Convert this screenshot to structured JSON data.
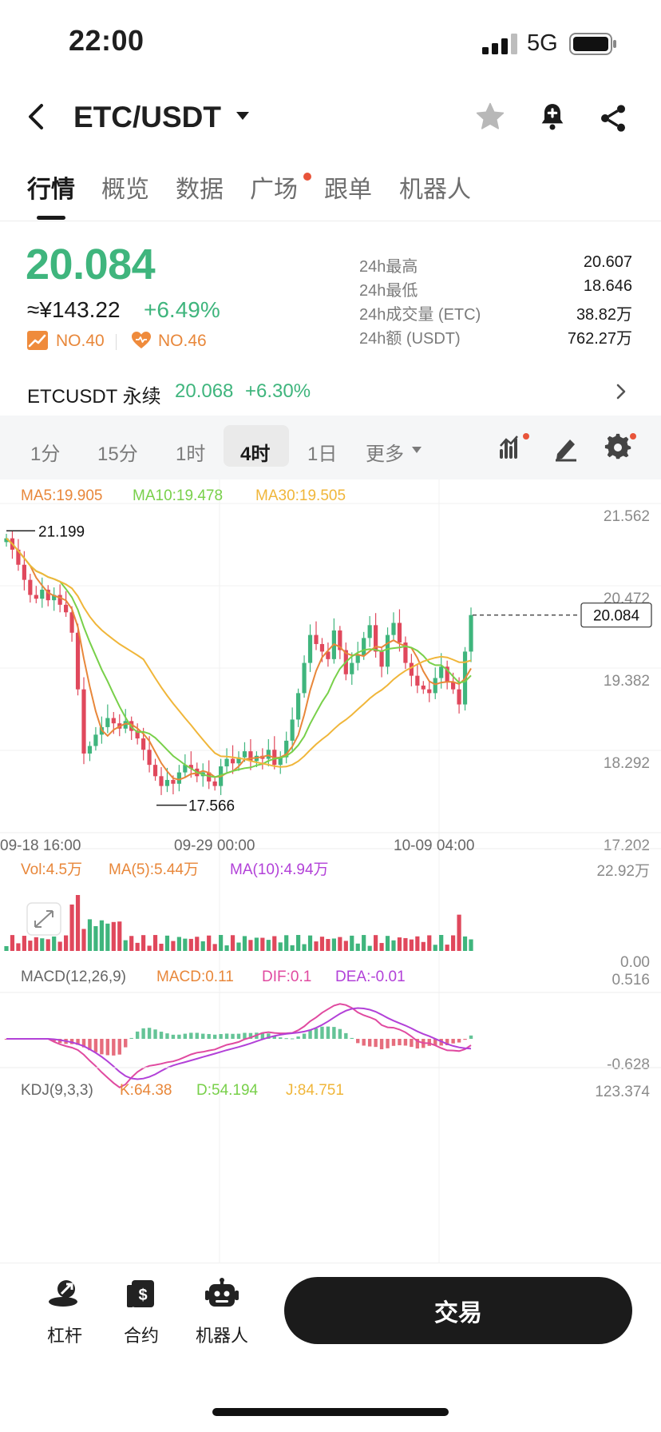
{
  "status": {
    "time": "22:00",
    "network": "5G"
  },
  "header": {
    "pair": "ETC/USDT",
    "icons": [
      "back-icon",
      "caret-down-icon",
      "star-icon",
      "bell-plus-icon",
      "share-icon"
    ]
  },
  "tabs": [
    {
      "label": "行情",
      "active": true
    },
    {
      "label": "概览"
    },
    {
      "label": "数据"
    },
    {
      "label": "广场",
      "dot": true
    },
    {
      "label": "跟单"
    },
    {
      "label": "机器人"
    }
  ],
  "ticker": {
    "price": "20.084",
    "cny": "≈¥143.22",
    "change": "+6.49%",
    "rank1": "NO.40",
    "rank2": "NO.46"
  },
  "stats": [
    {
      "label": "24h最高",
      "value": "20.607"
    },
    {
      "label": "24h最低",
      "value": "18.646"
    },
    {
      "label": "24h成交量 (ETC)",
      "value": "38.82万"
    },
    {
      "label": "24h额 (USDT)",
      "value": "762.27万"
    }
  ],
  "perp": {
    "label": "ETCUSDT 永续",
    "price": "20.068",
    "change": "+6.30%"
  },
  "timeframes": [
    {
      "label": "1分"
    },
    {
      "label": "15分"
    },
    {
      "label": "1时"
    },
    {
      "label": "4时",
      "active": true
    },
    {
      "label": "1日"
    },
    {
      "label": "更多"
    }
  ],
  "colors": {
    "up": "#3fb57d",
    "down": "#e0485c",
    "ma5": "#e8873a",
    "ma10": "#78d04a",
    "ma30": "#f0b63a",
    "purple": "#b241d8",
    "macd": "#e8873a",
    "dif": "#e04aa0"
  },
  "chart_data": {
    "type": "candlestick",
    "indicators": {
      "ma5": "MA5:19.905",
      "ma10": "MA10:19.478",
      "ma30": "MA30:19.505"
    },
    "y_ticks": [
      "21.562",
      "20.472",
      "19.382",
      "18.292",
      "17.202"
    ],
    "ylim": [
      17.202,
      21.562
    ],
    "x_ticks": [
      "09-18 16:00",
      "09-29 00:00",
      "10-09 04:00"
    ],
    "high_label": "21.199",
    "low_label": "17.566",
    "current_price": "20.084",
    "closes": [
      21.1,
      20.95,
      20.75,
      20.55,
      20.35,
      20.3,
      20.42,
      20.28,
      20.35,
      20.22,
      20.12,
      19.85,
      19.1,
      18.25,
      18.35,
      18.5,
      18.6,
      18.72,
      18.65,
      18.58,
      18.68,
      18.55,
      18.45,
      18.3,
      18.1,
      17.95,
      17.82,
      17.9,
      17.85,
      18.0,
      18.1,
      18.05,
      17.95,
      18.0,
      17.88,
      17.82,
      18.08,
      18.18,
      18.12,
      18.2,
      18.28,
      18.15,
      18.22,
      18.18,
      18.3,
      18.1,
      18.2,
      18.42,
      18.7,
      19.05,
      19.45,
      19.82,
      19.7,
      19.6,
      19.5,
      19.88,
      19.62,
      19.3,
      19.45,
      19.55,
      19.78,
      19.95,
      19.6,
      19.4,
      19.82,
      19.98,
      19.72,
      19.45,
      19.28,
      19.15,
      19.1,
      19.05,
      19.25,
      19.4,
      19.2,
      19.1,
      18.9,
      19.6,
      20.084
    ],
    "volume": {
      "vol": "Vol:4.5万",
      "ma5": "MA(5):5.44万",
      "ma10": "MA(10):4.94万",
      "y_max": "22.92万",
      "y_min": "0.00"
    },
    "macd": {
      "params": "MACD(12,26,9)",
      "macd": "MACD:0.11",
      "dif": "DIF:0.1",
      "dea": "DEA:-0.01",
      "y_max": "0.516",
      "y_min": "-0.628"
    },
    "kdj": {
      "params": "KDJ(9,3,3)",
      "k": "K:64.38",
      "d": "D:54.194",
      "j": "J:84.751",
      "y_max": "123.374"
    }
  },
  "bottom": {
    "items": [
      {
        "label": "杠杆"
      },
      {
        "label": "合约"
      },
      {
        "label": "机器人"
      }
    ],
    "trade": "交易"
  }
}
